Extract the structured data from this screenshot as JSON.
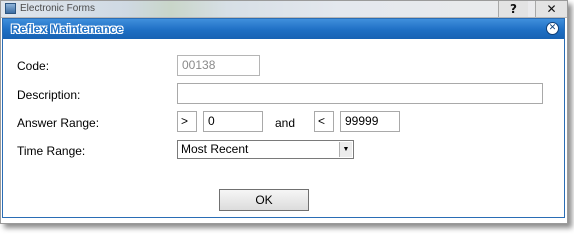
{
  "window": {
    "title": "Electronic Forms",
    "help_label": "?",
    "close_label": "✕"
  },
  "dialog": {
    "title": "Reflex Maintenance",
    "close_label": "✕"
  },
  "form": {
    "code_label": "Code:",
    "code_value": "00138",
    "description_label": "Description:",
    "description_value": "",
    "answer_range_label": "Answer Range:",
    "answer_op1": ">",
    "answer_value1": "0",
    "and_label": "and",
    "answer_op2": "<",
    "answer_value2": "99999",
    "time_range_label": "Time Range:",
    "time_range_value": "Most Recent",
    "ok_label": "OK"
  },
  "icons": {
    "app_icon": "app-window-icon",
    "dropdown": "chevron-down-icon"
  }
}
